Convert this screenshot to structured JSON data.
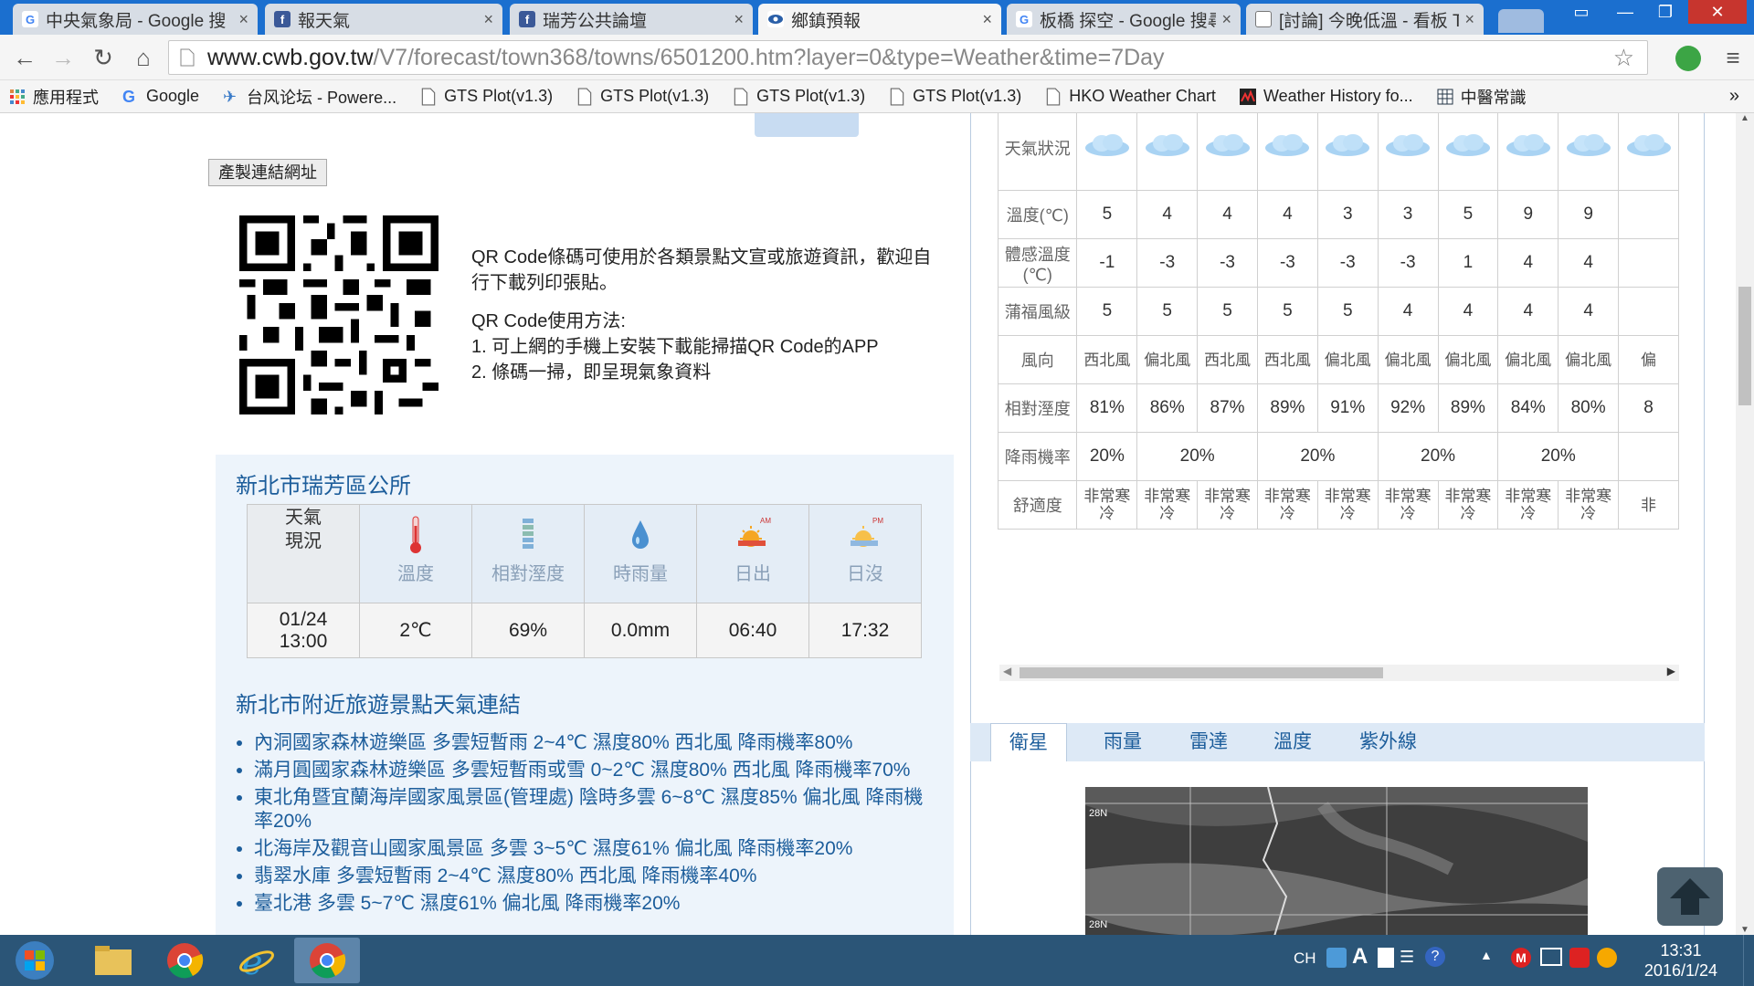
{
  "browser": {
    "tabs": [
      {
        "title": "中央氣象局 - Google 搜",
        "icon": "google-icon",
        "active": false
      },
      {
        "title": "報天氣",
        "icon": "facebook-icon",
        "active": false
      },
      {
        "title": "瑞芳公共論壇",
        "icon": "facebook-icon",
        "active": false
      },
      {
        "title": "鄉鎮預報",
        "icon": "cwb-icon",
        "active": true
      },
      {
        "title": "板橋 探空 - Google 搜尋",
        "icon": "google-icon",
        "active": false
      },
      {
        "title": "[討論] 今晚低溫 - 看板 T",
        "icon": "document-icon",
        "active": false
      }
    ],
    "url_host": "www.cwb.gov.tw",
    "url_path": "/V7/forecast/town368/towns/6501200.htm?layer=0&type=Weather&time=7Day",
    "bookmarks": [
      {
        "label": "應用程式",
        "icon": "apps-icon"
      },
      {
        "label": "Google",
        "icon": "google-icon"
      },
      {
        "label": "台风论坛 - Powere...",
        "icon": "typhoon-icon"
      },
      {
        "label": "GTS Plot(v1.3)",
        "icon": "document-icon"
      },
      {
        "label": "GTS Plot(v1.3)",
        "icon": "document-icon"
      },
      {
        "label": "GTS Plot(v1.3)",
        "icon": "document-icon"
      },
      {
        "label": "GTS Plot(v1.3)",
        "icon": "document-icon"
      },
      {
        "label": "HKO Weather Chart",
        "icon": "document-icon"
      },
      {
        "label": "Weather History fo...",
        "icon": "wunderground-icon"
      },
      {
        "label": "中醫常識",
        "icon": "grid-icon"
      }
    ],
    "more_bookmarks": "»"
  },
  "page": {
    "generate_link_button": "產製連結網址",
    "qr_text_1": "QR Code條碼可使用於各類景點文宣或旅遊資訊，歡迎自行下載列印張貼。",
    "qr_text_2": "QR Code使用方法:",
    "qr_text_3": "1. 可上網的手機上安裝下載能掃描QR Code的APP",
    "qr_text_4": "2. 條碼一掃，即呈現氣象資料",
    "town": {
      "title": "新北市瑞芳區公所",
      "label": "天氣\n現況",
      "headers": [
        "溫度",
        "相對溼度",
        "時雨量",
        "日出",
        "日沒"
      ],
      "time": "01/24\n13:00",
      "values": [
        "2℃",
        "69%",
        "0.0mm",
        "06:40",
        "17:32"
      ]
    },
    "spots": {
      "title": "新北市附近旅遊景點天氣連結",
      "items": [
        "內洞國家森林遊樂區 多雲短暫雨 2~4℃ 濕度80% 西北風 降雨機率80%",
        "滿月圓國家森林遊樂區 多雲短暫雨或雪 0~2℃ 濕度80% 西北風 降雨機率70%",
        "東北角暨宜蘭海岸國家風景區(管理處) 陰時多雲 6~8℃ 濕度85% 偏北風 降雨機率20%",
        "北海岸及觀音山國家風景區 多雲 3~5℃ 濕度61% 偏北風 降雨機率20%",
        "翡翠水庫 多雲短暫雨 2~4℃ 濕度80% 西北風 降雨機率40%",
        "臺北港 多雲 5~7℃ 濕度61% 偏北風 降雨機率20%"
      ]
    },
    "forecast": {
      "row_labels": [
        "天氣狀況",
        "溫度(℃)",
        "體感溫度(℃)",
        "蒲福風級",
        "風向",
        "相對溼度",
        "降雨機率",
        "舒適度"
      ],
      "temperature": [
        "5",
        "4",
        "4",
        "4",
        "3",
        "3",
        "5",
        "9",
        "9"
      ],
      "apparent": [
        "-1",
        "-3",
        "-3",
        "-3",
        "-3",
        "-3",
        "1",
        "4",
        "4"
      ],
      "beaufort": [
        "5",
        "5",
        "5",
        "5",
        "5",
        "4",
        "4",
        "4",
        "4"
      ],
      "wind_dir": [
        "西北風",
        "偏北風",
        "西北風",
        "西北風",
        "偏北風",
        "偏北風",
        "偏北風",
        "偏北風",
        "偏北風"
      ],
      "wind_dir_partial": "偏",
      "humidity": [
        "81%",
        "86%",
        "87%",
        "89%",
        "91%",
        "92%",
        "89%",
        "84%",
        "80%"
      ],
      "humidity_partial": "8",
      "rain": [
        "20%",
        "20%",
        "20%",
        "20%",
        "20%"
      ],
      "comfort": [
        "非常寒冷",
        "非常寒冷",
        "非常寒冷",
        "非常寒冷",
        "非常寒冷",
        "非常寒冷",
        "非常寒冷",
        "非常寒冷",
        "非常寒冷"
      ],
      "comfort_partial": "非"
    },
    "map_tabs": [
      "衛星",
      "雨量",
      "雷達",
      "溫度",
      "紫外線"
    ],
    "sat_labels": [
      "28N",
      "28N"
    ]
  },
  "taskbar": {
    "ime": "CH",
    "time": "13:31",
    "date": "2016/1/24"
  },
  "colors": {
    "accent": "#1c5d9b",
    "panel": "#edf4fb",
    "tabstrip": "#1b6fcf",
    "taskbar": "#2b5577"
  }
}
